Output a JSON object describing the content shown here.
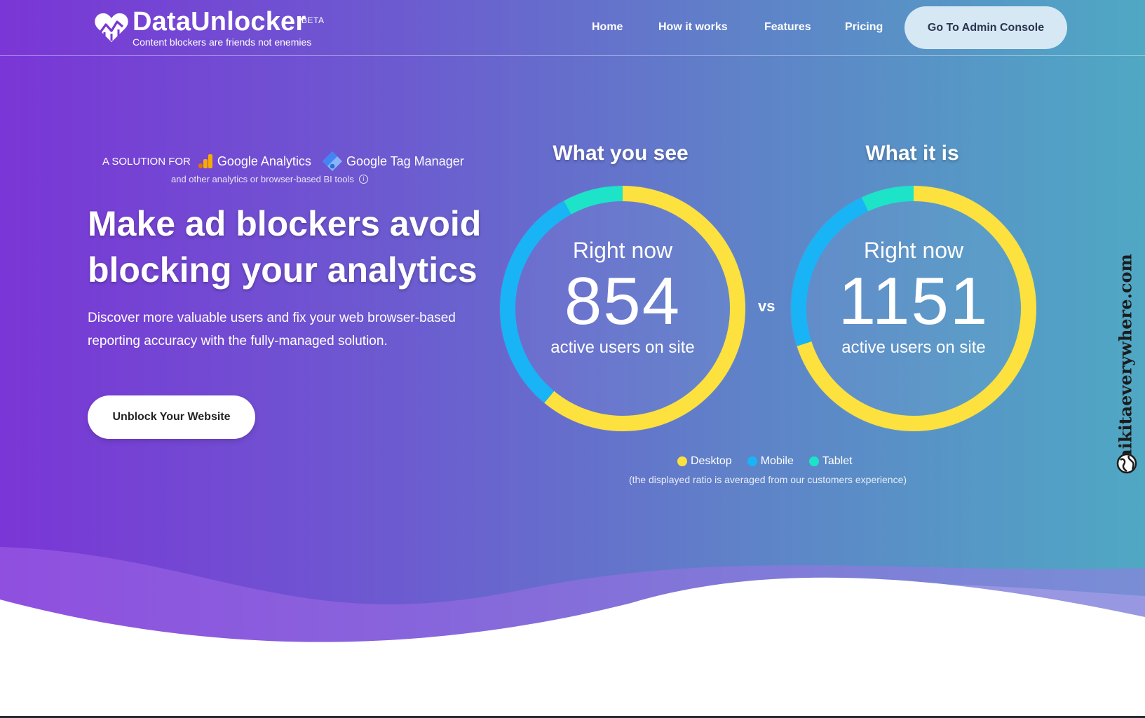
{
  "header": {
    "brand": "DataUnlocker",
    "beta": "BETA",
    "tagline": "Content blockers are friends not enemies",
    "nav": [
      "Home",
      "How it works",
      "Features",
      "Pricing"
    ],
    "admin_button": "Go To Admin Console"
  },
  "hero": {
    "solution_for": "A SOLUTION FOR",
    "ga": "Google Analytics",
    "gtm": "Google Tag Manager",
    "other_tools": "and other analytics or browser-based BI tools",
    "headline": "Make ad blockers avoid blocking your analytics",
    "lead": "Discover more valuable users and fix your web browser-based reporting accuracy with the fully-managed solution.",
    "cta": "Unblock Your Website"
  },
  "gauges": {
    "left_title": "What you see",
    "right_title": "What it is",
    "caption": "Right now",
    "left_value": "854",
    "right_value": "1151",
    "subcaption": "active users on site",
    "vs": "vs",
    "note": "(the displayed ratio is averaged from our customers experience)"
  },
  "legend": [
    {
      "label": "Desktop",
      "color": "#fce13f"
    },
    {
      "label": "Mobile",
      "color": "#19b4f5"
    },
    {
      "label": "Tablet",
      "color": "#1de3c8"
    }
  ],
  "gauge_split": {
    "left": {
      "desktop": 0.61,
      "mobile": 0.31,
      "tablet": 0.08
    },
    "right": {
      "desktop": 0.7,
      "mobile": 0.23,
      "tablet": 0.07
    }
  },
  "watermark": "nikitaeverywhere.com",
  "colors": {
    "accent_purple": "#7a36d6",
    "accent_teal": "#4fa8c4",
    "admin_button_bg": "#d6e8f4"
  }
}
